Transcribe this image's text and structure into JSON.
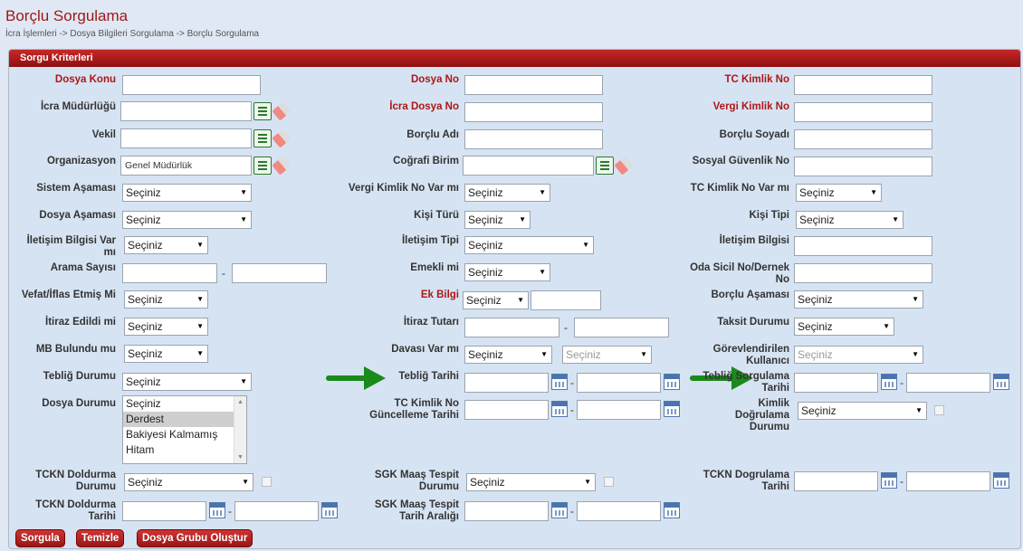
{
  "page": {
    "title": "Borçlu Sorgulama",
    "breadcrumb": "İcra İşlemleri -> Dosya Bilgileri Sorgulama -> Borçlu Sorgulama"
  },
  "panel": {
    "title": "Sorgu Kriterleri"
  },
  "labels": {
    "dosya_konu": "Dosya Konu",
    "dosya_no": "Dosya No",
    "tc_kimlik_no": "TC Kimlik No",
    "icra_mudurlugu": "İcra Müdürlüğü",
    "icra_dosya_no": "İcra Dosya No",
    "vergi_kimlik_no": "Vergi Kimlik No",
    "vekil": "Vekil",
    "borclu_adi": "Borçlu Adı",
    "borclu_soyadi": "Borçlu Soyadı",
    "organizasyon": "Organizasyon",
    "cografi_birim": "Coğrafi Birim",
    "sosyal_guvenlik_no": "Sosyal Güvenlik No",
    "sistem_asamasi": "Sistem Aşaması",
    "vergi_kimlik_var": "Vergi Kimlik No Var mı",
    "tc_kimlik_var": "TC Kimlik No Var mı",
    "dosya_asamasi": "Dosya Aşaması",
    "kisi_turu": "Kişi Türü",
    "kisi_tipi": "Kişi Tipi",
    "iletisim_bilgisi_var": "İletişim Bilgisi Var mı",
    "iletisim_tipi": "İletişim Tipi",
    "iletisim_bilgisi": "İletişim Bilgisi",
    "arama_sayisi": "Arama Sayısı",
    "emekli_mi": "Emekli mi",
    "oda_sicil": "Oda Sicil No/Dernek No",
    "vefat_iflas": "Vefat/İflas Etmiş Mi",
    "ek_bilgi": "Ek Bilgi",
    "borclu_asamasi": "Borçlu Aşaması",
    "itiraz_edildi": "İtiraz Edildi mi",
    "itiraz_tutari": "İtiraz Tutarı",
    "taksit_durumu": "Taksit Durumu",
    "mb_bulundu": "MB Bulundu mu",
    "davasi_var": "Davası Var mı",
    "gorevlendirilen": "Görevlendirilen Kullanıcı",
    "teblig_durumu": "Tebliğ Durumu",
    "teblig_tarihi": "Tebliğ Tarihi",
    "teblig_sorgulama_tarihi": "Tebliğ Sorgulama Tarihi",
    "dosya_durumu": "Dosya Durumu",
    "tc_guncelleme": "TC Kimlik No Güncelleme Tarihi",
    "kimlik_dogrulama": "Kimlik Doğrulama Durumu",
    "tckn_doldurma_durumu": "TCKN Doldurma Durumu",
    "sgk_maas_durumu": "SGK Maaş Tespit Durumu",
    "tckn_dogrulama_tarihi": "TCKN Dogrulama Tarihi",
    "tckn_doldurma_tarihi": "TCKN Doldurma Tarihi",
    "sgk_maas_tarih": "SGK Maaş Tespit Tarih Aralığı"
  },
  "values": {
    "organizasyon": "Genel Müdürlük",
    "select_default": "Seçiniz"
  },
  "dosya_durumu_options": [
    "Seçiniz",
    "Derdest",
    "Bakiyesi Kalmamış",
    "Hitam"
  ],
  "buttons": {
    "sorgula": "Sorgula",
    "temizle": "Temizle",
    "grup": "Dosya Grubu Oluştur"
  },
  "colors": {
    "accent": "#b01616",
    "arrow": "#1a8a1a"
  }
}
